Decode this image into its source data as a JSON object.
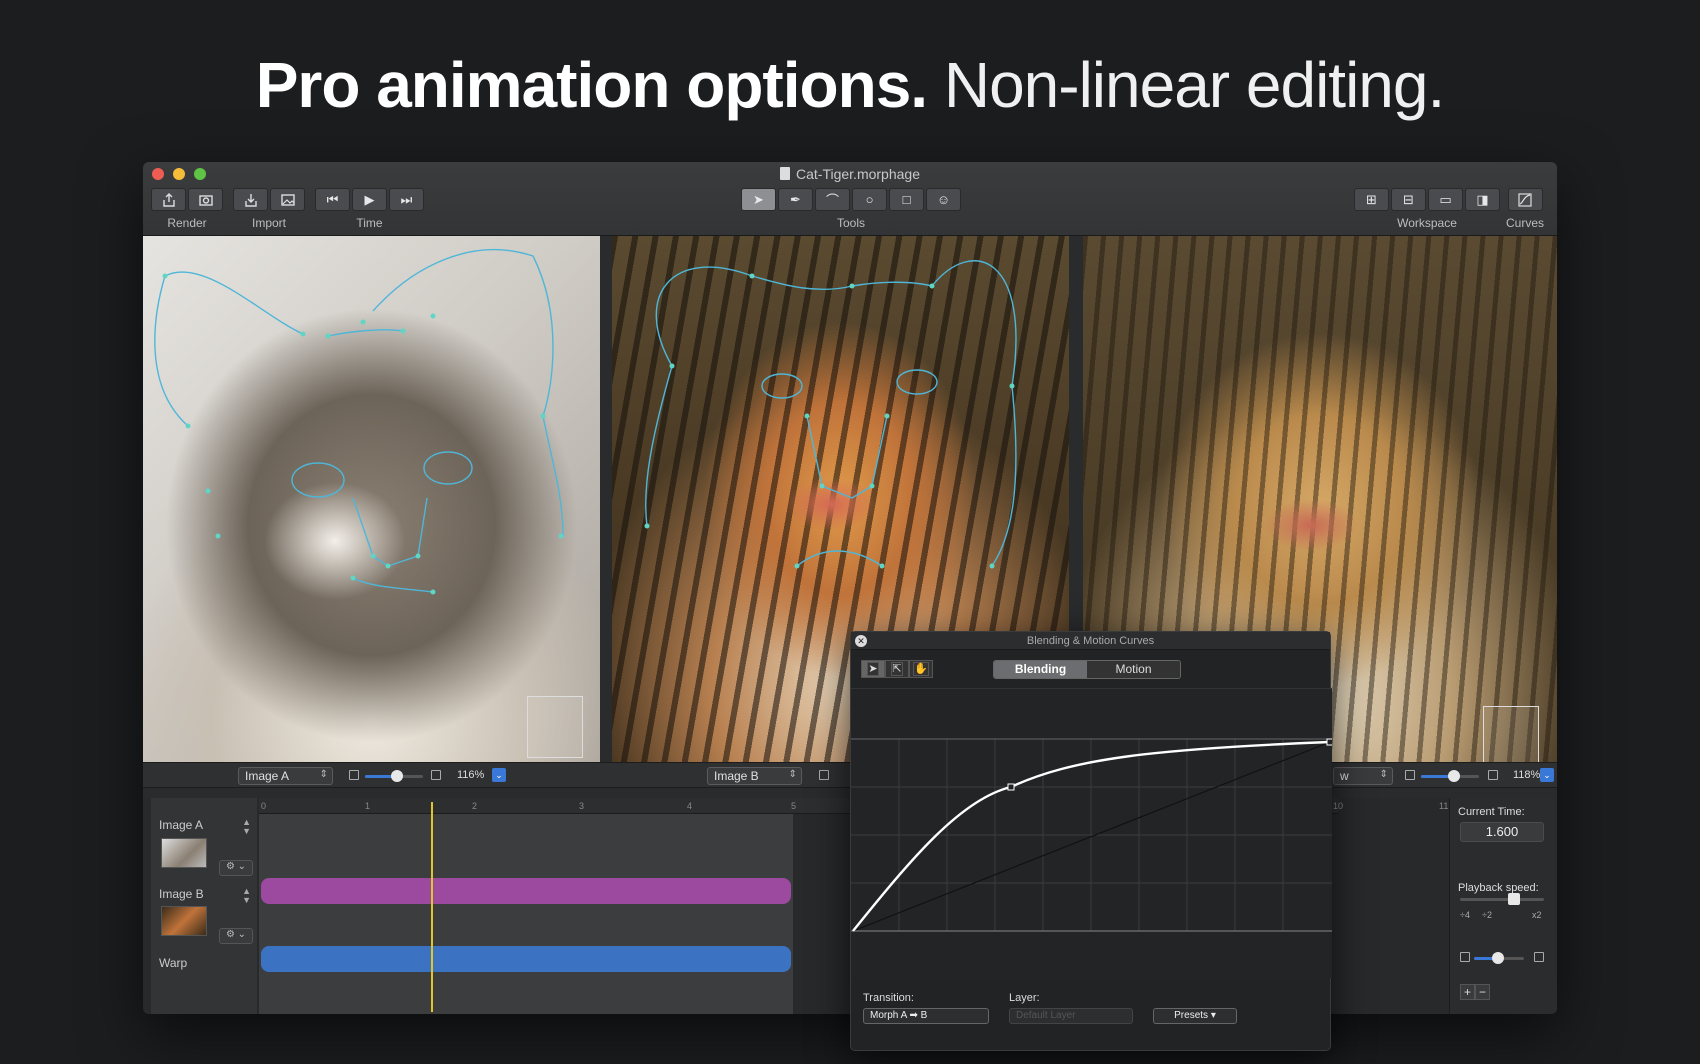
{
  "headline": {
    "bold": "Pro animation options.",
    "light": "Non-linear editing."
  },
  "window": {
    "title": "Cat-Tiger.morphage",
    "traffic_lights": {
      "close": "#ee5d53",
      "minimize": "#f5bd3a",
      "zoom": "#5fc645"
    },
    "toolbar": {
      "render_label": "Render",
      "import_label": "Import",
      "time_label": "Time",
      "tools_label": "Tools",
      "workspace_label": "Workspace",
      "curves_label": "Curves"
    }
  },
  "viewer_bar": {
    "left_select": "Image A",
    "left_zoom": "116%",
    "middle_select": "Image B",
    "right_select": "w",
    "right_zoom": "118%"
  },
  "timeline": {
    "ruler": [
      "0",
      "1",
      "2",
      "3",
      "4",
      "5",
      "10",
      "11"
    ],
    "tracks": [
      {
        "label": "Image A",
        "color": "#9b4a9f"
      },
      {
        "label": "Image B",
        "color": "#3b72c2"
      },
      {
        "label": "Warp"
      }
    ],
    "playhead_color": "#e0c42c"
  },
  "side_panel": {
    "current_time_label": "Current Time:",
    "current_time": "1.600",
    "playback_label": "Playback speed:",
    "speed_ticks": [
      "÷4",
      "÷2",
      "x2"
    ],
    "plus": "+",
    "minus": "−"
  },
  "curves_panel": {
    "title": "Blending & Motion Curves",
    "tabs": [
      "Blending",
      "Motion"
    ],
    "active_tab": "Blending",
    "transition_label": "Transition:",
    "transition_value": "Morph A ➡ B",
    "layer_label": "Layer:",
    "layer_value": "Default Layer",
    "presets_label": "Presets"
  },
  "accent_color": "#3a78d8"
}
